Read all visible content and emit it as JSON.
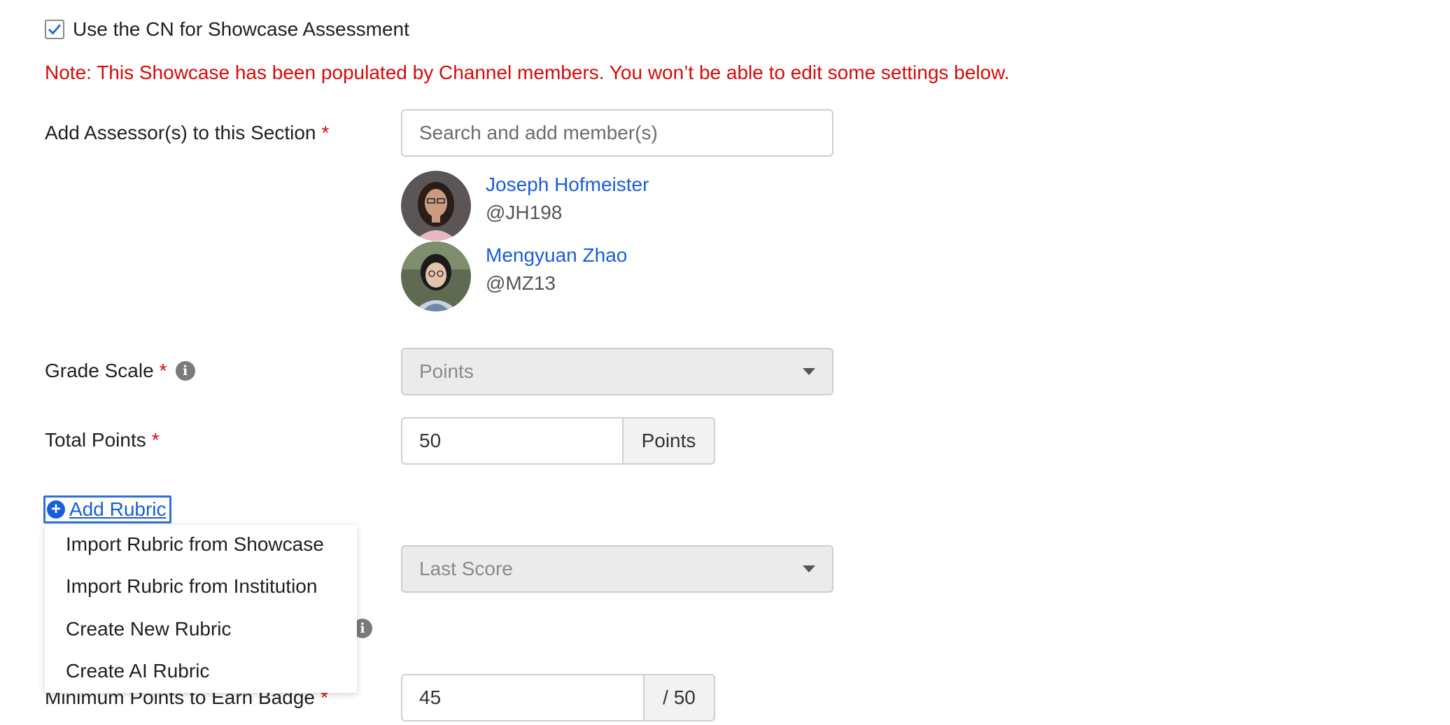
{
  "showcase_assessment": {
    "checked": true,
    "label": "Use the CN for Showcase Assessment"
  },
  "note": "Note: This Showcase has been populated by Channel members. You won’t be able to edit some settings below.",
  "assessors": {
    "label": "Add Assessor(s) to this Section",
    "required_mark": "*",
    "search_placeholder": "Search and add member(s)",
    "members": [
      {
        "name": "Joseph Hofmeister",
        "handle": "@JH198"
      },
      {
        "name": "Mengyuan Zhao",
        "handle": "@MZ13"
      }
    ]
  },
  "grade_scale": {
    "label": "Grade Scale",
    "required_mark": "*",
    "value": "Points"
  },
  "total_points": {
    "label": "Total Points",
    "required_mark": "*",
    "value": "50",
    "unit": "Points"
  },
  "add_rubric": {
    "label": "Add Rubric",
    "menu": [
      "Import Rubric from Showcase",
      "Import Rubric from Institution",
      "Create New Rubric",
      "Create AI Rubric"
    ]
  },
  "score_policy": {
    "value": "Last Score"
  },
  "min_points": {
    "label": "Minimum Points to Earn Badge",
    "required_mark": "*",
    "value": "45",
    "suffix": "/ 50"
  },
  "colors": {
    "accent": "#1a5dd8",
    "required": "#d60a0a",
    "note": "#d60a0a"
  }
}
